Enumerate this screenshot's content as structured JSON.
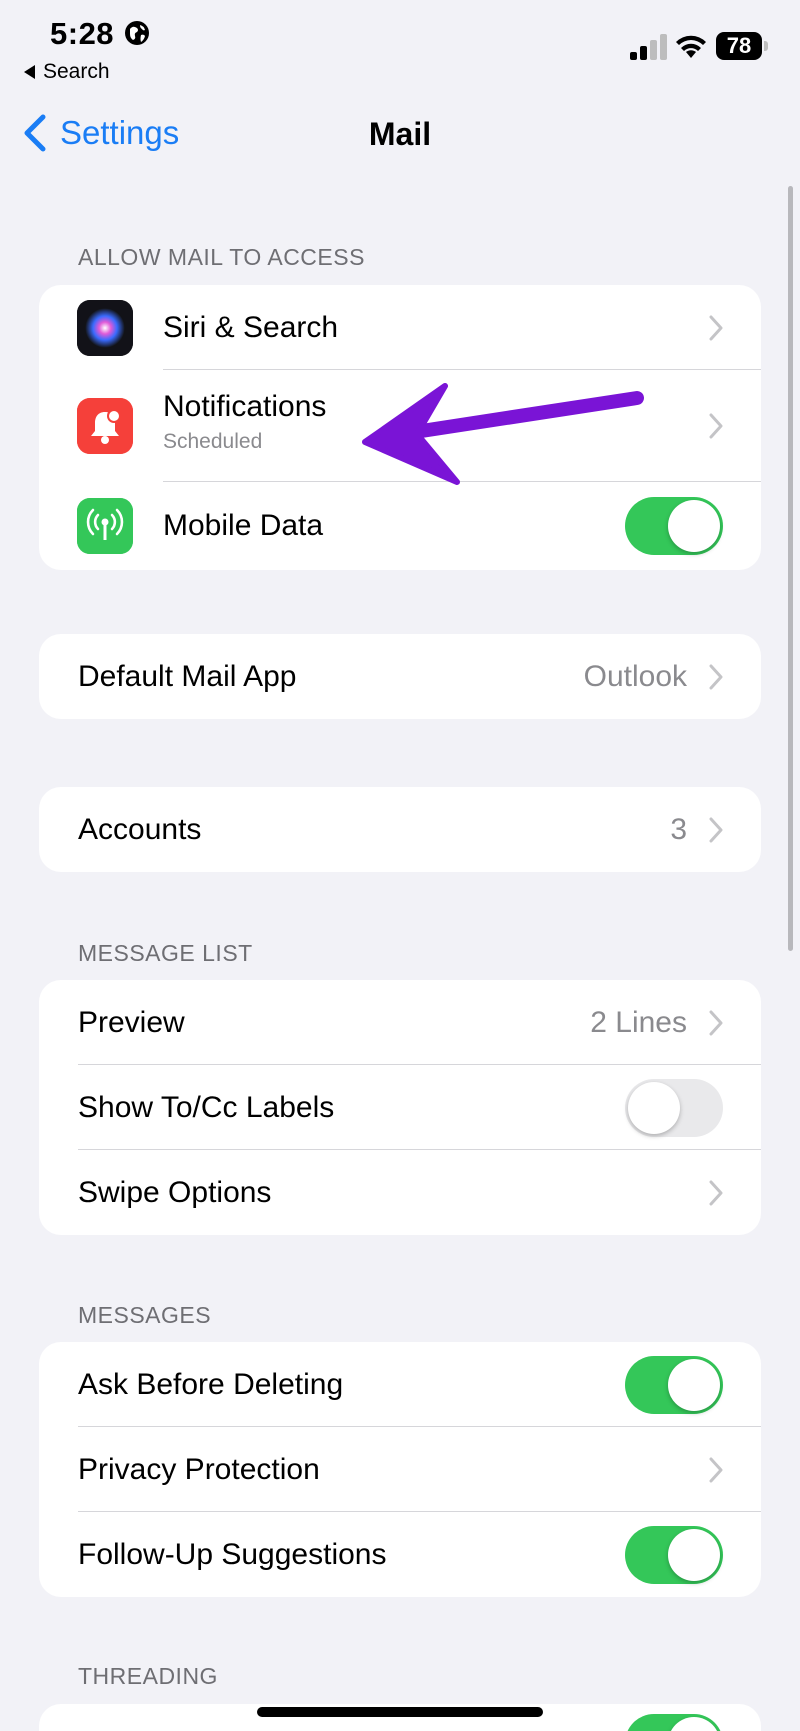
{
  "status_bar": {
    "time": "5:28",
    "back_app": "Search",
    "battery": "78"
  },
  "nav": {
    "back_label": "Settings",
    "title": "Mail"
  },
  "sections": {
    "allow_access": {
      "header": "ALLOW MAIL TO ACCESS",
      "siri": {
        "label": "Siri & Search"
      },
      "notifications": {
        "label": "Notifications",
        "sub": "Scheduled"
      },
      "mobile_data": {
        "label": "Mobile Data",
        "on": true
      }
    },
    "default_app": {
      "label": "Default Mail App",
      "value": "Outlook"
    },
    "accounts": {
      "label": "Accounts",
      "value": "3"
    },
    "message_list": {
      "header": "MESSAGE LIST",
      "preview": {
        "label": "Preview",
        "value": "2 Lines"
      },
      "show_tocc": {
        "label": "Show To/Cc Labels",
        "on": false
      },
      "swipe": {
        "label": "Swipe Options"
      }
    },
    "messages": {
      "header": "MESSAGES",
      "ask_delete": {
        "label": "Ask Before Deleting",
        "on": true
      },
      "privacy": {
        "label": "Privacy Protection"
      },
      "follow_up": {
        "label": "Follow-Up Suggestions",
        "on": true
      }
    },
    "threading": {
      "header": "THREADING"
    }
  },
  "colors": {
    "accent": "#1a7df5",
    "toggle_on": "#34c759",
    "notifications_icon": "#f5403a",
    "mobile_data_icon": "#34c759",
    "annotation_arrow": "#7a14d6"
  },
  "icons": [
    "globe-icon",
    "signal-icon",
    "wifi-icon",
    "battery-icon",
    "back-chevron-icon",
    "siri-icon",
    "bell-icon",
    "antenna-icon",
    "chevron-right-icon",
    "annotation-arrow"
  ]
}
